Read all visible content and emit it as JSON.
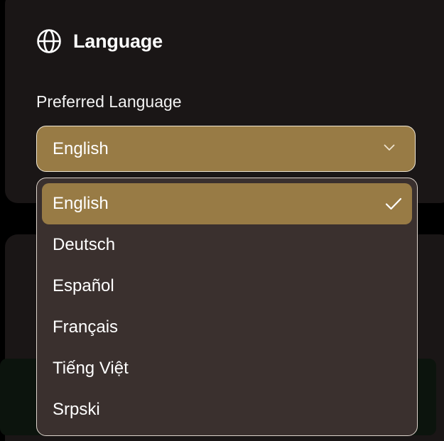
{
  "section": {
    "title": "Language",
    "icon": "globe-icon"
  },
  "field": {
    "label": "Preferred Language",
    "selected_value": "English"
  },
  "dropdown": {
    "options": [
      {
        "label": "English",
        "selected": true
      },
      {
        "label": "Deutsch",
        "selected": false
      },
      {
        "label": "Español",
        "selected": false
      },
      {
        "label": "Français",
        "selected": false
      },
      {
        "label": "Tiếng Việt",
        "selected": false
      },
      {
        "label": "Srpski",
        "selected": false
      }
    ]
  },
  "colors": {
    "background": "#000000",
    "card": "#1a1616",
    "accent": "#987b45",
    "dropdown_bg": "#3a302e",
    "border": "#efe6d4",
    "green_panel": "#0c140d"
  }
}
